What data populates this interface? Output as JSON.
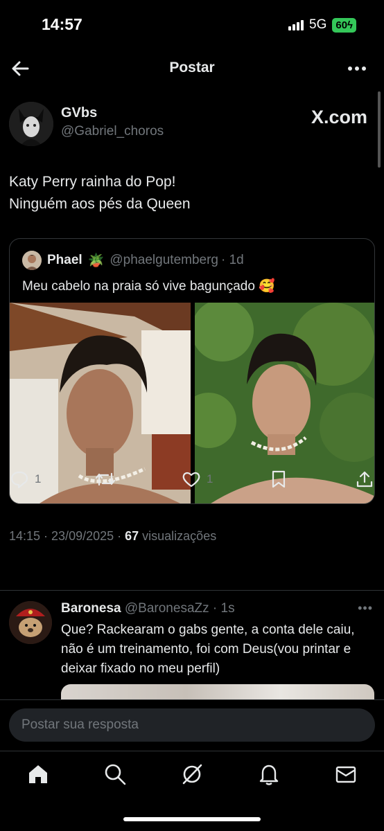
{
  "status_bar": {
    "time": "14:57",
    "network": "5G",
    "battery": "60"
  },
  "header": {
    "title": "Postar"
  },
  "post": {
    "author_name": "GVbs",
    "author_handle": "@Gabriel_choros",
    "watermark": "X.com",
    "text_line1": "Katy Perry rainha do Pop!",
    "text_line2": "Ninguém aos pés da Queen",
    "timestamp": "14:15 · 23/09/2025 · ",
    "views_count": "67",
    "views_label": " visualizações",
    "replies": "1",
    "likes": "1"
  },
  "quote": {
    "name": "Phael",
    "emoji": "🪴",
    "handle": "@phaelgutemberg",
    "age": "· 1d",
    "text": "Meu cabelo na praia só vive bagunçado 🥰"
  },
  "reply": {
    "name": "Baronesa",
    "handle": "@BaronesaZz",
    "age": "· 1s",
    "more": "•••",
    "text": "Que? Rackearam o gabs gente, a conta dele caiu, não é um treinamento, foi com Deus(vou printar e deixar fixado no meu perfil)"
  },
  "composer": {
    "placeholder": "Postar sua resposta"
  },
  "icons": {
    "back": "arrow-left-icon",
    "more": "more-horizontal-icon",
    "reply": "reply-icon",
    "repost": "repost-icon",
    "like": "heart-icon",
    "bookmark": "bookmark-icon",
    "share": "share-icon",
    "home": "home-icon",
    "search": "search-icon",
    "grok": "grok-icon",
    "notifications": "bell-icon",
    "messages": "mail-icon"
  },
  "colors": {
    "background": "#000000",
    "text": "#e7e9ea",
    "muted": "#71767b",
    "border": "#2f3336",
    "battery": "#34c759"
  }
}
